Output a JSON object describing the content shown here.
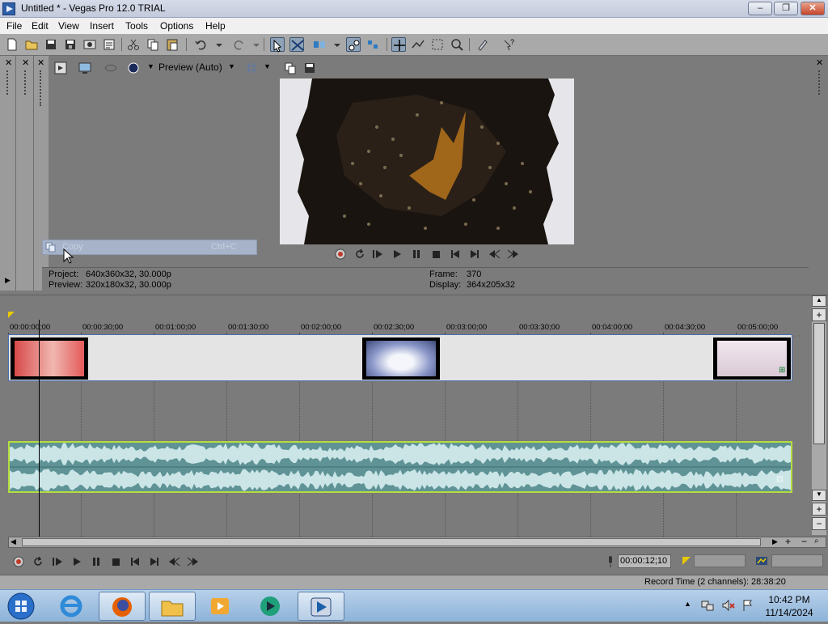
{
  "window": {
    "title": "Untitled * - Vegas Pro 12.0 TRIAL",
    "minimize": "–",
    "maximize": "❐",
    "close": "✕"
  },
  "menu": [
    "File",
    "Edit",
    "View",
    "Insert",
    "Tools",
    "Options",
    "Help"
  ],
  "preview_toolbar": {
    "quality": "Preview (Auto)"
  },
  "context_menu": {
    "item_label": "Copy",
    "item_shortcut": "Ctrl+C"
  },
  "info": {
    "project_label": "Project:",
    "project_value": "640x360x32, 30.000p",
    "preview_label": "Preview:",
    "preview_value": "320x180x32, 30.000p",
    "frame_label": "Frame:",
    "frame_value": "370",
    "display_label": "Display:",
    "display_value": "364x205x32"
  },
  "ruler": {
    "ticks": [
      "00:00:00;00",
      "00:00:30;00",
      "00:01:00;00",
      "00:01:30;00",
      "00:02:00;00",
      "00:02:30;00",
      "00:03:00;00",
      "00:03:30;00",
      "00:04:00;00",
      "00:04:30;00",
      "00:05:00;00"
    ]
  },
  "timeline": {
    "cursor_time": "00:00:12;10"
  },
  "status": {
    "record_time": "Record Time (2 channels): 28:38:20"
  },
  "taskbar": {
    "time": "10:42 PM",
    "date": "11/14/2024"
  },
  "colors": {
    "audio_event": "#5f9396",
    "audio_border": "#b6dc3e",
    "video_border": "#4a6fb0",
    "context_highlight": "#a6b3c9"
  }
}
